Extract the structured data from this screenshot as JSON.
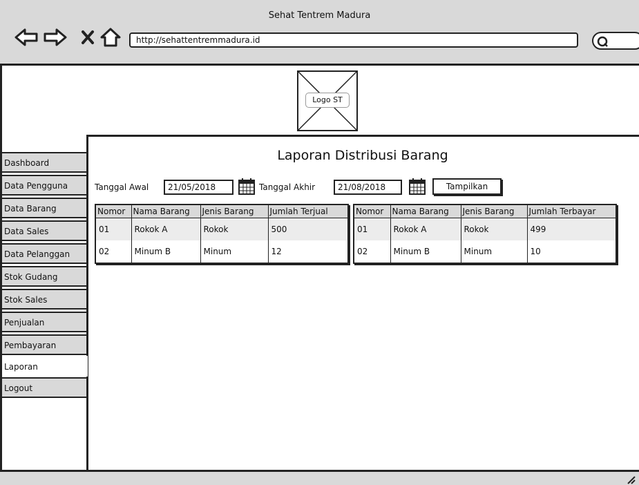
{
  "window": {
    "title": "Sehat Tentrem Madura",
    "url": "http://sehattentremmadura.id"
  },
  "logo": {
    "label": "Logo ST"
  },
  "sidebar": {
    "items": [
      {
        "label": "Dashboard"
      },
      {
        "label": "Data Pengguna"
      },
      {
        "label": "Data Barang"
      },
      {
        "label": "Data Sales"
      },
      {
        "label": "Data Pelanggan"
      },
      {
        "label": "Stok Gudang"
      },
      {
        "label": "Stok Sales"
      },
      {
        "label": "Penjualan"
      },
      {
        "label": "Pembayaran"
      },
      {
        "label": "Laporan"
      },
      {
        "label": "Logout"
      }
    ],
    "active": "Laporan"
  },
  "page": {
    "title": "Laporan Distribusi Barang"
  },
  "filter": {
    "start_label": "Tanggal Awal",
    "start_value": "21/05/2018",
    "end_label": "Tanggal Akhir",
    "end_value": "21/08/2018",
    "submit_label": "Tampilkan",
    "calendar_icon": "calendar-icon"
  },
  "table_sold": {
    "headers": [
      "Nomor",
      "Nama Barang",
      "Jenis Barang",
      "Jumlah Terjual"
    ],
    "rows": [
      [
        "01",
        "Rokok A",
        "Rokok",
        "500"
      ],
      [
        "02",
        "Minum B",
        "Minum",
        "12"
      ]
    ]
  },
  "table_paid": {
    "headers": [
      "Nomor",
      "Nama Barang",
      "Jenis Barang",
      "Jumlah Terbayar"
    ],
    "rows": [
      [
        "01",
        "Rokok A",
        "Rokok",
        "499"
      ],
      [
        "02",
        "Minum B",
        "Minum",
        "10"
      ]
    ]
  },
  "colors": {
    "chrome": "#d9d9d9",
    "border": "#222222",
    "row_alt": "#ececec"
  }
}
